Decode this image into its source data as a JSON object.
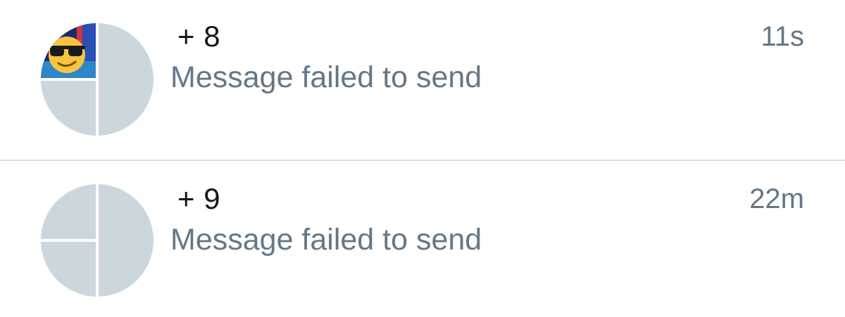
{
  "conversations": [
    {
      "title": "+ 8",
      "preview": "Message failed to send",
      "time": "11s",
      "avatar": {
        "photo_icon": "sunglasses-emoji-icon",
        "placeholder_color": "#ccd6dd"
      }
    },
    {
      "title": "+ 9",
      "preview": "Message failed to send",
      "time": "22m",
      "avatar": {
        "photo_icon": null,
        "placeholder_color": "#ccd6dd"
      }
    }
  ],
  "colors": {
    "title": "#14171a",
    "secondary_text": "#657786",
    "divider": "#dcdfe3",
    "avatar_placeholder": "#ccd6dd"
  }
}
